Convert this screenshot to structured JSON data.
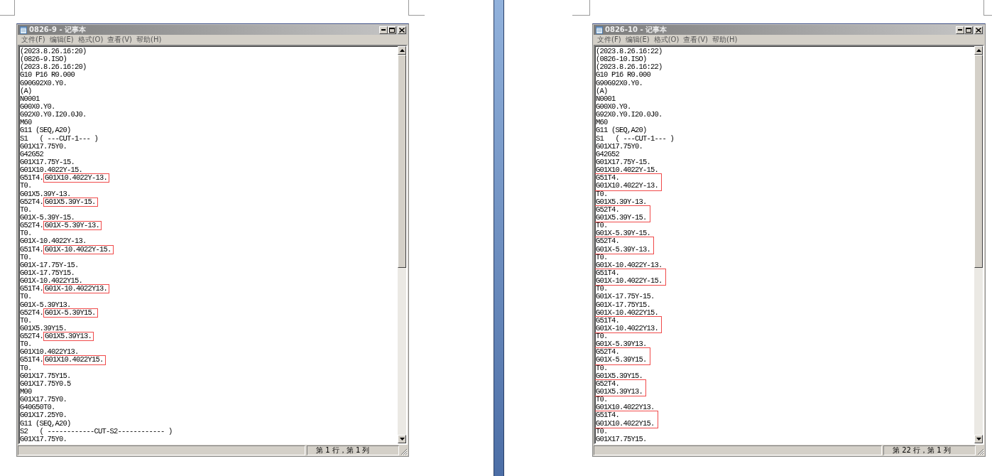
{
  "pages": [
    {
      "window": {
        "title": "0826-9 - 记事本",
        "menu": [
          "文件(F)",
          "编辑(E)",
          "格式(O)",
          "查看(V)",
          "帮助(H)"
        ],
        "lines": [
          {
            "kind": "plain",
            "text": "(2023.8.26.16:20)"
          },
          {
            "kind": "plain",
            "text": "(0826-9.ISO)"
          },
          {
            "kind": "plain",
            "text": "(2023.8.26.16:20)"
          },
          {
            "kind": "plain",
            "text": "G10 P16 R0.000"
          },
          {
            "kind": "plain",
            "text": "G90G92X0.Y0."
          },
          {
            "kind": "plain",
            "text": "(A)"
          },
          {
            "kind": "plain",
            "text": "N0001"
          },
          {
            "kind": "plain",
            "text": "G00X0.Y0."
          },
          {
            "kind": "plain",
            "text": "G92X0.Y0.I20.0J0."
          },
          {
            "kind": "plain",
            "text": "M60"
          },
          {
            "kind": "plain",
            "text": "G11 (SEQ,A20)"
          },
          {
            "kind": "plain",
            "text": "S1   ( ---CUT-1--- )"
          },
          {
            "kind": "plain",
            "text": "G01X17.75Y0."
          },
          {
            "kind": "plain",
            "text": "G42G52"
          },
          {
            "kind": "plain",
            "text": "G01X17.75Y-15."
          },
          {
            "kind": "plain",
            "text": "G01X10.4022Y-15."
          },
          {
            "kind": "inline_box",
            "text": "G51T4.",
            "boxed": "G01X10.4022Y-13."
          },
          {
            "kind": "plain",
            "text": "T0."
          },
          {
            "kind": "plain",
            "text": "G01X5.39Y-13."
          },
          {
            "kind": "inline_box",
            "text": "G52T4.",
            "boxed": "G01X5.39Y-15."
          },
          {
            "kind": "plain",
            "text": "T0."
          },
          {
            "kind": "plain",
            "text": "G01X-5.39Y-15."
          },
          {
            "kind": "inline_box",
            "text": "G52T4.",
            "boxed": "G01X-5.39Y-13."
          },
          {
            "kind": "plain",
            "text": "T0."
          },
          {
            "kind": "plain",
            "text": "G01X-10.4022Y-13."
          },
          {
            "kind": "inline_box",
            "text": "G51T4.",
            "boxed": "G01X-10.4022Y-15."
          },
          {
            "kind": "plain",
            "text": "T0."
          },
          {
            "kind": "plain",
            "text": "G01X-17.75Y-15."
          },
          {
            "kind": "plain",
            "text": "G01X-17.75Y15."
          },
          {
            "kind": "plain",
            "text": "G01X-10.4022Y15."
          },
          {
            "kind": "inline_box",
            "text": "G51T4.",
            "boxed": "G01X-10.4022Y13."
          },
          {
            "kind": "plain",
            "text": "T0."
          },
          {
            "kind": "plain",
            "text": "G01X-5.39Y13."
          },
          {
            "kind": "inline_box",
            "text": "G52T4.",
            "boxed": "G01X-5.39Y15."
          },
          {
            "kind": "plain",
            "text": "T0."
          },
          {
            "kind": "plain",
            "text": "G01X5.39Y15."
          },
          {
            "kind": "inline_box",
            "text": "G52T4.",
            "boxed": "G01X5.39Y13."
          },
          {
            "kind": "plain",
            "text": "T0."
          },
          {
            "kind": "plain",
            "text": "G01X10.4022Y13."
          },
          {
            "kind": "inline_box",
            "text": "G51T4.",
            "boxed": "G01X10.4022Y15."
          },
          {
            "kind": "plain",
            "text": "T0."
          },
          {
            "kind": "plain",
            "text": "G01X17.75Y15."
          },
          {
            "kind": "plain",
            "text": "G01X17.75Y0.5"
          },
          {
            "kind": "plain",
            "text": "M00"
          },
          {
            "kind": "plain",
            "text": "G01X17.75Y0."
          },
          {
            "kind": "plain",
            "text": "G40G50T0."
          },
          {
            "kind": "plain",
            "text": "G01X17.25Y0."
          },
          {
            "kind": "plain",
            "text": "G11 (SEQ,A20)"
          },
          {
            "kind": "plain",
            "text": "S2   ( ------------CUT-S2------------ )"
          },
          {
            "kind": "plain",
            "text": "G01X17.75Y0."
          }
        ],
        "status": "第 1 行，第 1 列"
      }
    },
    {
      "window": {
        "title": "0826-10 - 记事本",
        "menu": [
          "文件(F)",
          "编辑(E)",
          "格式(O)",
          "查看(V)",
          "帮助(H)"
        ],
        "lines": [
          {
            "kind": "plain",
            "text": "(2023.8.26.16:22)"
          },
          {
            "kind": "plain",
            "text": "(0826-10.ISO)"
          },
          {
            "kind": "plain",
            "text": "(2023.8.26.16:22)"
          },
          {
            "kind": "plain",
            "text": "G10 P16 R0.000"
          },
          {
            "kind": "plain",
            "text": "G90G92X0.Y0."
          },
          {
            "kind": "plain",
            "text": "(A)"
          },
          {
            "kind": "plain",
            "text": "N0001"
          },
          {
            "kind": "plain",
            "text": "G00X0.Y0."
          },
          {
            "kind": "plain",
            "text": "G92X0.Y0.I20.0J0."
          },
          {
            "kind": "plain",
            "text": "M60"
          },
          {
            "kind": "plain",
            "text": "G11 (SEQ,A20)"
          },
          {
            "kind": "plain",
            "text": "S1   ( ---CUT-1--- )"
          },
          {
            "kind": "plain",
            "text": "G01X17.75Y0."
          },
          {
            "kind": "plain",
            "text": "G42G52"
          },
          {
            "kind": "plain",
            "text": "G01X17.75Y-15."
          },
          {
            "kind": "plain",
            "text": "G01X10.4022Y-15."
          },
          {
            "kind": "box_group",
            "lines": [
              "G51T4.",
              "G01X10.4022Y-13."
            ]
          },
          {
            "kind": "plain",
            "text": "T0."
          },
          {
            "kind": "plain",
            "text": "G01X5.39Y-13."
          },
          {
            "kind": "box_group",
            "lines": [
              "G52T4.",
              "G01X5.39Y-15."
            ]
          },
          {
            "kind": "plain",
            "text": "T0."
          },
          {
            "kind": "plain",
            "text": "G01X-5.39Y-15."
          },
          {
            "kind": "box_group",
            "lines": [
              "G52T4.",
              "G01X-5.39Y-13."
            ]
          },
          {
            "kind": "plain",
            "text": "T0."
          },
          {
            "kind": "plain",
            "text": "G01X-10.4022Y-13."
          },
          {
            "kind": "box_group",
            "lines": [
              "G51T4.",
              "G01X-10.4022Y-15."
            ]
          },
          {
            "kind": "plain",
            "text": "T0."
          },
          {
            "kind": "plain",
            "text": "G01X-17.75Y-15."
          },
          {
            "kind": "plain",
            "text": "G01X-17.75Y15."
          },
          {
            "kind": "plain",
            "text": "G01X-10.4022Y15."
          },
          {
            "kind": "box_group",
            "lines": [
              "G51T4.",
              "G01X-10.4022Y13."
            ]
          },
          {
            "kind": "plain",
            "text": "T0."
          },
          {
            "kind": "plain",
            "text": "G01X-5.39Y13."
          },
          {
            "kind": "box_group",
            "lines": [
              "G52T4.",
              "G01X-5.39Y15."
            ]
          },
          {
            "kind": "plain",
            "text": "T0."
          },
          {
            "kind": "plain",
            "text": "G01X5.39Y15."
          },
          {
            "kind": "box_group",
            "lines": [
              "G52T4.",
              "G01X5.39Y13."
            ]
          },
          {
            "kind": "plain",
            "text": "T0."
          },
          {
            "kind": "plain",
            "text": "G01X10.4022Y13."
          },
          {
            "kind": "box_group",
            "lines": [
              "G51T4.",
              "G01X10.4022Y15."
            ]
          },
          {
            "kind": "plain",
            "text": "T0."
          },
          {
            "kind": "plain",
            "text": "G01X17.75Y15."
          }
        ],
        "status": "第 22 行，第 1 列"
      }
    }
  ]
}
